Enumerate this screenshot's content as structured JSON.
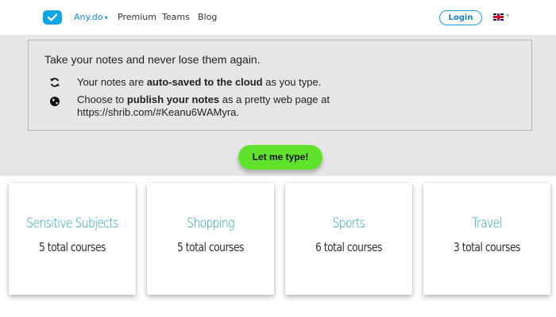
{
  "nav": {
    "brand": "Any.do",
    "brand_caret": "▾",
    "links": [
      "Premium",
      "Teams",
      "Blog"
    ],
    "login": "Login",
    "lang_caret": "▾"
  },
  "info": {
    "intro": "Take your notes and never lose them again.",
    "autosave": {
      "icon": "sync-icon",
      "pre": "Your notes are ",
      "bold": "auto-saved to the cloud",
      "post": " as you type."
    },
    "publish": {
      "icon": "globe-icon",
      "pre": "Choose to ",
      "bold": "publish your notes",
      "post": " as a pretty web page at https://shrib.com/#Keanu6WAMyra."
    }
  },
  "cta": {
    "label": "Let me type!"
  },
  "cards": [
    {
      "title": "Sensitive Subjects",
      "count": "5 total courses"
    },
    {
      "title": "Shopping",
      "count": "5 total courses"
    },
    {
      "title": "Sports",
      "count": "6 total courses"
    },
    {
      "title": "Travel",
      "count": "3 total courses"
    }
  ],
  "colors": {
    "accent_blue": "#12a5e6",
    "cta_green": "#5ee22b",
    "card_title_teal": "#16a4a0"
  }
}
